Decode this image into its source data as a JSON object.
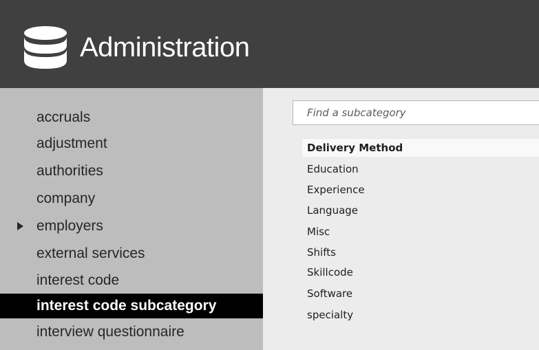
{
  "header": {
    "title": "Administration"
  },
  "sidebar": {
    "items": [
      {
        "label": "accruals"
      },
      {
        "label": "adjustment"
      },
      {
        "label": "authorities"
      },
      {
        "label": "company"
      },
      {
        "label": "employers",
        "has_children": true
      },
      {
        "label": "external services"
      },
      {
        "label": "interest code"
      },
      {
        "label": "interest code subcategory",
        "active": true
      },
      {
        "label": "interview questionnaire"
      }
    ]
  },
  "main": {
    "search": {
      "placeholder": "Find a subcategory",
      "value": ""
    },
    "subcategories": [
      {
        "label": "Delivery Method",
        "highlighted": true
      },
      {
        "label": "Education"
      },
      {
        "label": "Experience"
      },
      {
        "label": "Language"
      },
      {
        "label": "Misc"
      },
      {
        "label": "Shifts"
      },
      {
        "label": "Skillcode"
      },
      {
        "label": "Software"
      },
      {
        "label": "specialty"
      }
    ]
  },
  "colors": {
    "header_bg": "#404040",
    "sidebar_bg": "#bdbdbd",
    "main_bg": "#ececec",
    "active_bg": "#000000"
  },
  "icons": {
    "header": "database-icon",
    "expand": "caret-right-icon"
  }
}
